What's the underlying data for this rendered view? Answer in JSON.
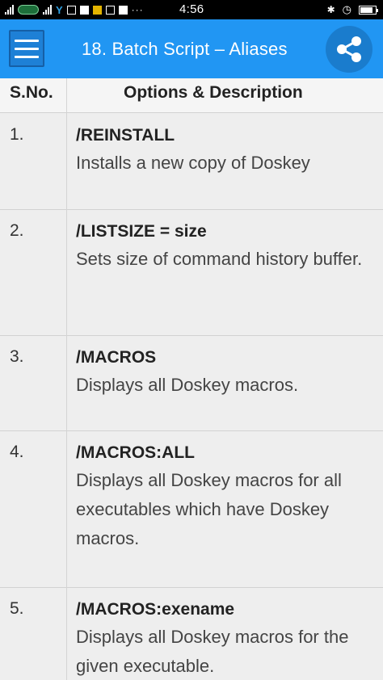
{
  "status_bar": {
    "time": "4:56"
  },
  "app_bar": {
    "title": "18. Batch Script – Aliases",
    "menu_icon": "hamburger-menu-icon",
    "share_icon": "share-icon"
  },
  "table": {
    "headers": [
      "S.No.",
      "Options & Description"
    ],
    "rows": [
      {
        "sno": "1.",
        "option": "/REINSTALL",
        "description": "Installs a new copy of Doskey"
      },
      {
        "sno": "2.",
        "option": "/LISTSIZE = size",
        "description": "Sets size of command history buffer."
      },
      {
        "sno": "3.",
        "option": "/MACROS",
        "description": "Displays all Doskey macros."
      },
      {
        "sno": "4.",
        "option": "/MACROS:ALL",
        "description": "Displays all Doskey macros for all executables which have Doskey macros."
      },
      {
        "sno": "5.",
        "option": "/MACROS:exename",
        "description": "Displays all Doskey macros for the given executable."
      }
    ]
  },
  "colors": {
    "app_bar": "#2196f3",
    "status_bar": "#000000",
    "table_bg": "#eeeeee"
  }
}
